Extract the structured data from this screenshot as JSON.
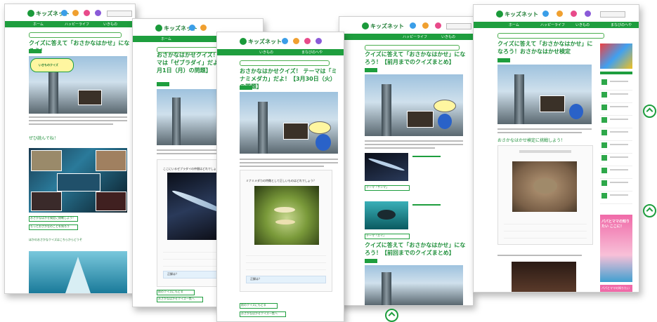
{
  "site": {
    "logo_text": "キッズネット",
    "nav_items": [
      "ホーム",
      "ハッピーライフ",
      "いきもの",
      "まなびのへや"
    ]
  },
  "pages": [
    {
      "title": "クイズに答えて「おさかなはかせ」になろう！",
      "hero_caption": "いきものクイズ",
      "section_label": "ぜひ読んでね！",
      "links": [
        "おさかなはかせ検定に挑戦しよう！",
        "もっとおさかなのことを知ろう"
      ],
      "footer_text": "ほかのおさかなクイズはこちらからどうぞ"
    },
    {
      "title": "おさかなはかせクイズ！ テーマは「ゼブラダイ」だよ！【3月1日（月）の問題】",
      "quiz_question": "ここにいるゼブラダイの仲間はどれでしょう？",
      "answer_label": "正解は？",
      "btn_back": "前のクイズにもどる",
      "btn_list": "おさかなはかせクイズ一覧へ"
    },
    {
      "title": "おさかなはかせクイズ！ テーマは「ミナミメダカ」だよ！【3月30日（火）の問題】",
      "quiz_question": "ミナミメダカの特徴として正しいものはどれでしょう？",
      "answer_label": "正解は？",
      "btn_back": "前のクイズにもどる",
      "btn_list": "おさかなはかせクイズ一覧へ"
    },
    {
      "title": "クイズに答えて「おさかなはかせ」になろう！【前月までのクイズまとめ】",
      "thumb_label_1": "テーマ「サンマ」",
      "thumb_label_2": "テーマ「エイ」",
      "title2": "クイズに答えて「おさかなはかせ」になろう！【前回までのクイズまとめ】"
    },
    {
      "title": "クイズに答えて「おさかなはかせ」になろう！おさかなはかせ検定",
      "section_label": "おさかなはかせ検定に挑戦しよう！",
      "banner_text": "パパとママの知りたい ここに！",
      "banner_text2": "パパとママの知りたい"
    }
  ],
  "colors": {
    "accent": "#1e9e3e",
    "nav": "#1e9e3e",
    "title": "#1e8f3a"
  },
  "icons": [
    "scroll-to-top-icon"
  ]
}
